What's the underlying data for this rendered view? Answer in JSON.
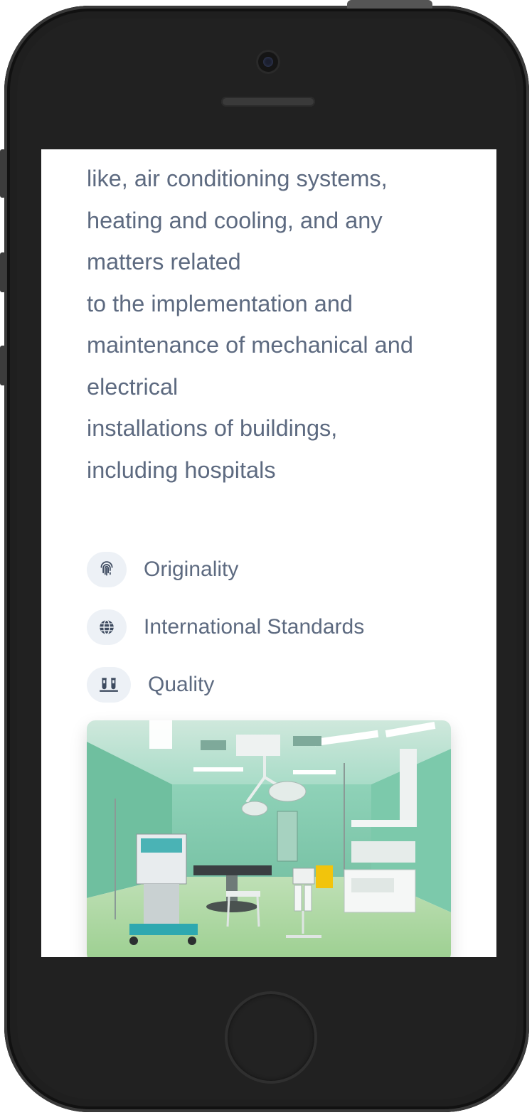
{
  "about": {
    "paragraph_lines": [
      "like, air conditioning systems,",
      "heating and cooling, and any",
      "matters related",
      "to the implementation and",
      "maintenance of mechanical and",
      "electrical",
      "installations of buildings,",
      "including hospitals"
    ]
  },
  "features": [
    {
      "label": "Originality",
      "icon": "fingerprint-icon"
    },
    {
      "label": "International Standards",
      "icon": "globe-icon"
    },
    {
      "label": "Quality",
      "icon": "test-tubes-icon"
    }
  ],
  "colors": {
    "text": "#5d6a80",
    "icon_bg": "#edf1f6",
    "icon": "#3d4a5f"
  }
}
